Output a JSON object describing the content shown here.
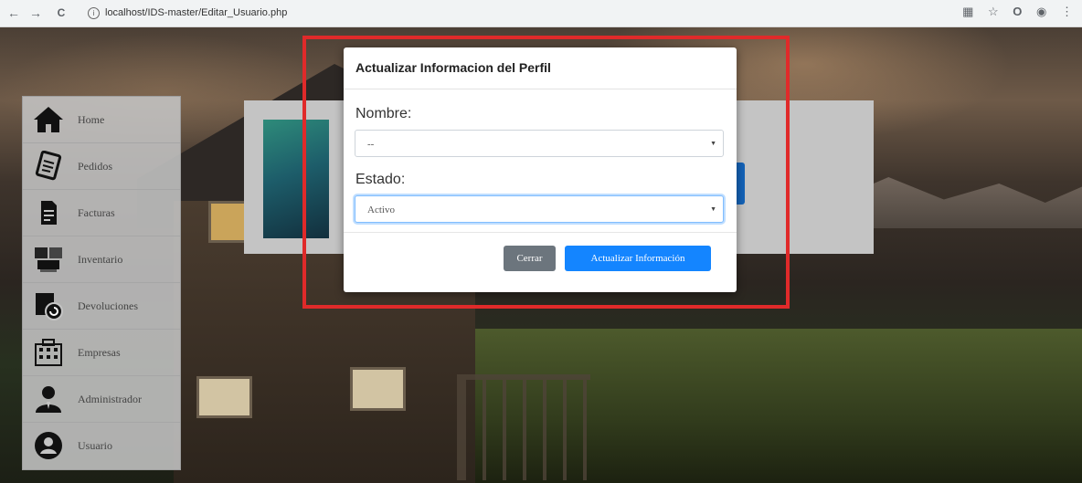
{
  "browser": {
    "url": "localhost/IDS-master/Editar_Usuario.php",
    "back_icon": "←",
    "forward_icon": "→",
    "reload_icon": "C"
  },
  "sidebar": {
    "items": [
      {
        "label": "Home",
        "icon": "house-icon"
      },
      {
        "label": "Pedidos",
        "icon": "order-icon"
      },
      {
        "label": "Facturas",
        "icon": "invoice-icon"
      },
      {
        "label": "Inventario",
        "icon": "inventory-icon"
      },
      {
        "label": "Devoluciones",
        "icon": "return-icon"
      },
      {
        "label": "Empresas",
        "icon": "building-icon"
      },
      {
        "label": "Administrador",
        "icon": "admin-icon"
      },
      {
        "label": "Usuario",
        "icon": "user-icon"
      }
    ]
  },
  "modal": {
    "title": "Actualizar Informacion del Perfil",
    "nombre_label": "Nombre:",
    "nombre_value": "--",
    "estado_label": "Estado:",
    "estado_value": "Activo",
    "close_label": "Cerrar",
    "update_label": "Actualizar Información"
  },
  "colors": {
    "highlight": "#e02a2a",
    "primary": "#1485ff",
    "secondary": "#6c757d"
  }
}
